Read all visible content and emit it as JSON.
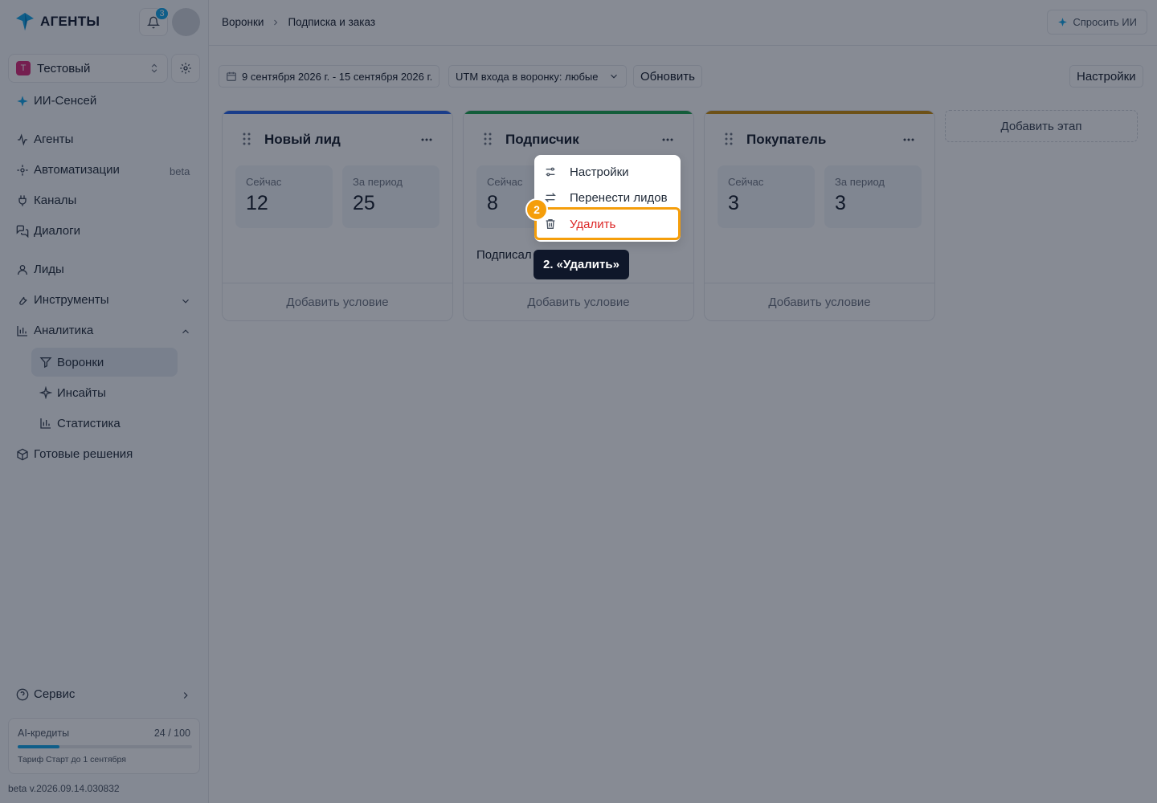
{
  "app": {
    "name": "АГЕНТЫ",
    "notifications_count": "3"
  },
  "workspace": {
    "letter": "Т",
    "name": "Тестовый"
  },
  "sidebar": {
    "ai_sensei": "ИИ-Сенсей",
    "items": {
      "agents": "Агенты",
      "automations": "Автоматизации",
      "automations_badge": "beta",
      "channels": "Каналы",
      "dialogs": "Диалоги",
      "leads": "Лиды",
      "tools": "Инструменты",
      "analytics": "Аналитика",
      "funnels": "Воронки",
      "insights": "Инсайты",
      "statistics": "Статистика",
      "solutions": "Готовые решения",
      "service": "Сервис"
    },
    "credits": {
      "label": "AI-кредиты",
      "value": "24 / 100",
      "fraction": 0.24,
      "plan": "Тариф Старт до 1 сентября"
    },
    "version": "beta v.2026.09.14.030832"
  },
  "header": {
    "breadcrumb": [
      "Воронки",
      "Подписка и заказ"
    ],
    "ask_ai": "Спросить ИИ"
  },
  "toolbar": {
    "date_range": "9 сентября 2026 г. - 15 сентября 2026 г.",
    "utm_filter": "UTM входа в воронку: любые",
    "refresh": "Обновить",
    "settings": "Настройки"
  },
  "stages": [
    {
      "title": "Новый лид",
      "color": "#2563eb",
      "now_label": "Сейчас",
      "now": "12",
      "period_label": "За период",
      "period": "25",
      "add_condition": "Добавить условие"
    },
    {
      "title": "Подписчик",
      "color": "#16a34a",
      "now_label": "Сейчас",
      "now": "8",
      "condition_text": "Подписал",
      "add_condition": "Добавить условие"
    },
    {
      "title": "Покупатель",
      "color": "#ca8a04",
      "now_label": "Сейчас",
      "now": "3",
      "period_label": "За период",
      "period": "3",
      "add_condition": "Добавить условие"
    }
  ],
  "add_stage": "Добавить этап",
  "context_menu": {
    "items": [
      "Настройки",
      "Перенести лидов",
      "Удалить"
    ]
  },
  "guide": {
    "step": "2",
    "tooltip": "2. «Удалить»"
  },
  "colors": {
    "accent": "#0ea5e9",
    "highlight": "#f59e0b",
    "danger": "#dc2626"
  }
}
